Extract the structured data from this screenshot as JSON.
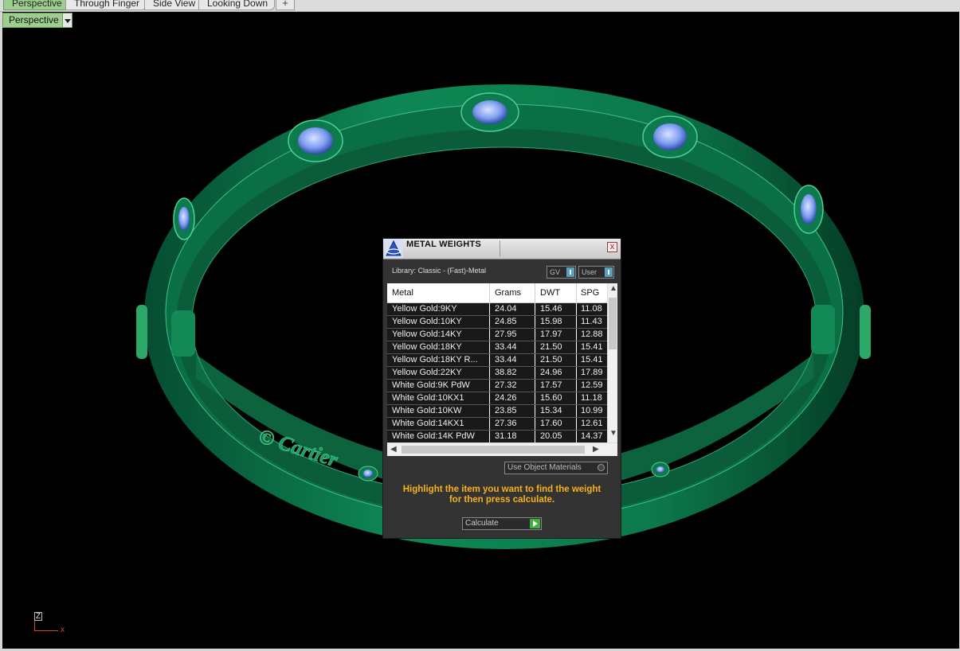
{
  "tabs": [
    {
      "label": "Perspective",
      "active": true
    },
    {
      "label": "Through Finger",
      "active": false
    },
    {
      "label": "Side View",
      "active": false
    },
    {
      "label": "Looking Down",
      "active": false
    }
  ],
  "add_tab_glyph": "+",
  "viewport": {
    "label": "Perspective",
    "axis_z": "Z",
    "axis_x": "x",
    "engraving_text": "© Cartier"
  },
  "dialog": {
    "title": "METAL WEIGHTS",
    "close_glyph": "x",
    "library": "Library: Classic - (Fast)-Metal",
    "toggle_gv": "GV",
    "toggle_user": "User",
    "columns": [
      "Metal",
      "Grams",
      "DWT",
      "SPG"
    ],
    "rows": [
      [
        "Yellow Gold:9KY",
        "24.04",
        "15.46",
        "11.08"
      ],
      [
        "Yellow Gold:10KY",
        "24.85",
        "15.98",
        "11.43"
      ],
      [
        "Yellow Gold:14KY",
        "27.95",
        "17.97",
        "12.88"
      ],
      [
        "Yellow Gold:18KY",
        "33.44",
        "21.50",
        "15.41"
      ],
      [
        "Yellow Gold:18KY R...",
        "33.44",
        "21.50",
        "15.41"
      ],
      [
        "Yellow Gold:22KY",
        "38.82",
        "24.96",
        "17.89"
      ],
      [
        "White Gold:9K PdW",
        "27.32",
        "17.57",
        "12.59"
      ],
      [
        "White Gold:10KX1",
        "24.26",
        "15.60",
        "11.18"
      ],
      [
        "White Gold:10KW",
        "23.85",
        "15.34",
        "10.99"
      ],
      [
        "White Gold:14KX1",
        "27.36",
        "17.60",
        "12.61"
      ],
      [
        "White Gold:14K PdW",
        "31.18",
        "20.05",
        "14.37"
      ]
    ],
    "use_object_materials": "Use Object Materials",
    "hint_line1": "Highlight the item you want to find the weight",
    "hint_line2": "for then press calculate.",
    "calculate": "Calculate"
  },
  "colors": {
    "metal_green": "#0f7a4f",
    "gem_blue": "#9ab8ff",
    "hint": "#f5b21b",
    "active_tab": "#9ccf8f"
  }
}
